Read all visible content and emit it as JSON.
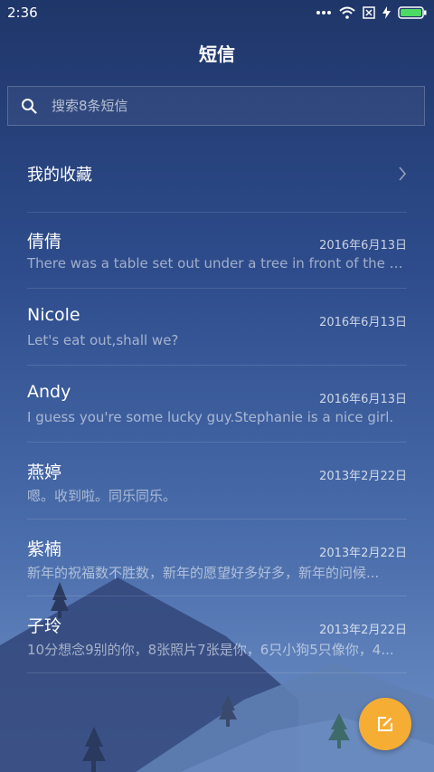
{
  "status_bar": {
    "time": "2:36"
  },
  "header": {
    "title": "短信"
  },
  "search": {
    "placeholder": "搜索8条短信"
  },
  "favorites": {
    "label": "我的收藏"
  },
  "conversations": [
    {
      "name": "倩倩",
      "date": "2016年6月13日",
      "preview": "There was a table set out under a tree in front of the ho..."
    },
    {
      "name": "Nicole",
      "date": "2016年6月13日",
      "preview": "Let's eat out,shall we?"
    },
    {
      "name": "Andy",
      "date": "2016年6月13日",
      "preview": "I guess you're some lucky guy.Stephanie is a nice girl."
    },
    {
      "name": "燕婷",
      "date": "2013年2月22日",
      "preview": "嗯。收到啦。同乐同乐。"
    },
    {
      "name": "紫楠",
      "date": "2013年2月22日",
      "preview": "新年的祝福数不胜数，新年的愿望好多好多，新年的问候..."
    },
    {
      "name": "子玲",
      "date": "2013年2月22日",
      "preview": "10分想念9别的你，8张照片7张是你，6只小狗5只像你，4..."
    }
  ],
  "colors": {
    "accent": "#f6ad34",
    "battery": "#4cd964"
  },
  "icons": {
    "search": "search-icon",
    "compose": "compose-icon",
    "chevron": "chevron-right-icon"
  }
}
